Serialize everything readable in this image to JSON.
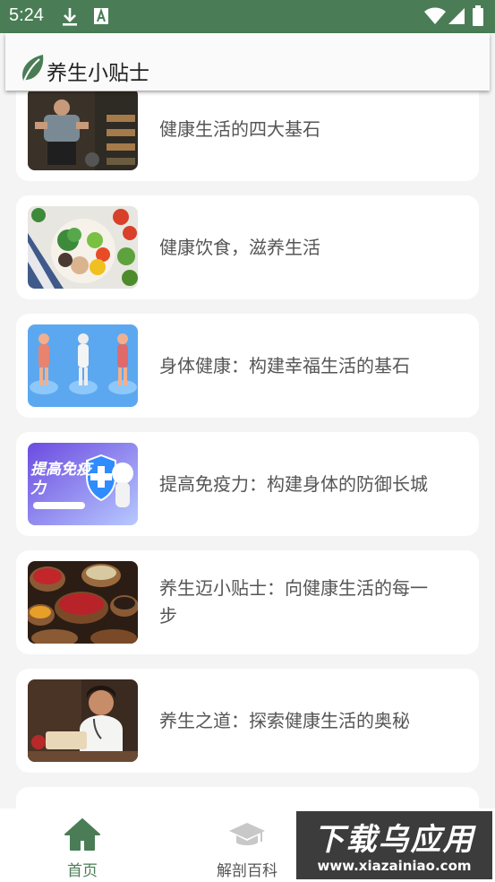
{
  "status_bar": {
    "time": "5:24"
  },
  "app_bar": {
    "title": "养生小贴士"
  },
  "articles": [
    {
      "title": "健康生活的四大基石"
    },
    {
      "title": "健康饮食，滋养生活"
    },
    {
      "title": "身体健康：构建幸福生活的基石"
    },
    {
      "title": "提高免疫力：构建身体的防御长城",
      "thumb_text": "提高免疫力"
    },
    {
      "title": "养生迈小贴士：向健康生活的每一步"
    },
    {
      "title": "养生之道：探索健康生活的奥秘"
    }
  ],
  "bottom_nav": {
    "items": [
      {
        "label": "首页",
        "icon": "home-icon",
        "active": true
      },
      {
        "label": "解剖百科",
        "icon": "graduation-cap-icon",
        "active": false
      }
    ]
  },
  "watermark": {
    "text_main": "下载乌应用",
    "text_url": "www.xiazainiao.com"
  },
  "colors": {
    "status_bar": "#4a7d56",
    "accent": "#4a7d56",
    "text": "#555555"
  }
}
